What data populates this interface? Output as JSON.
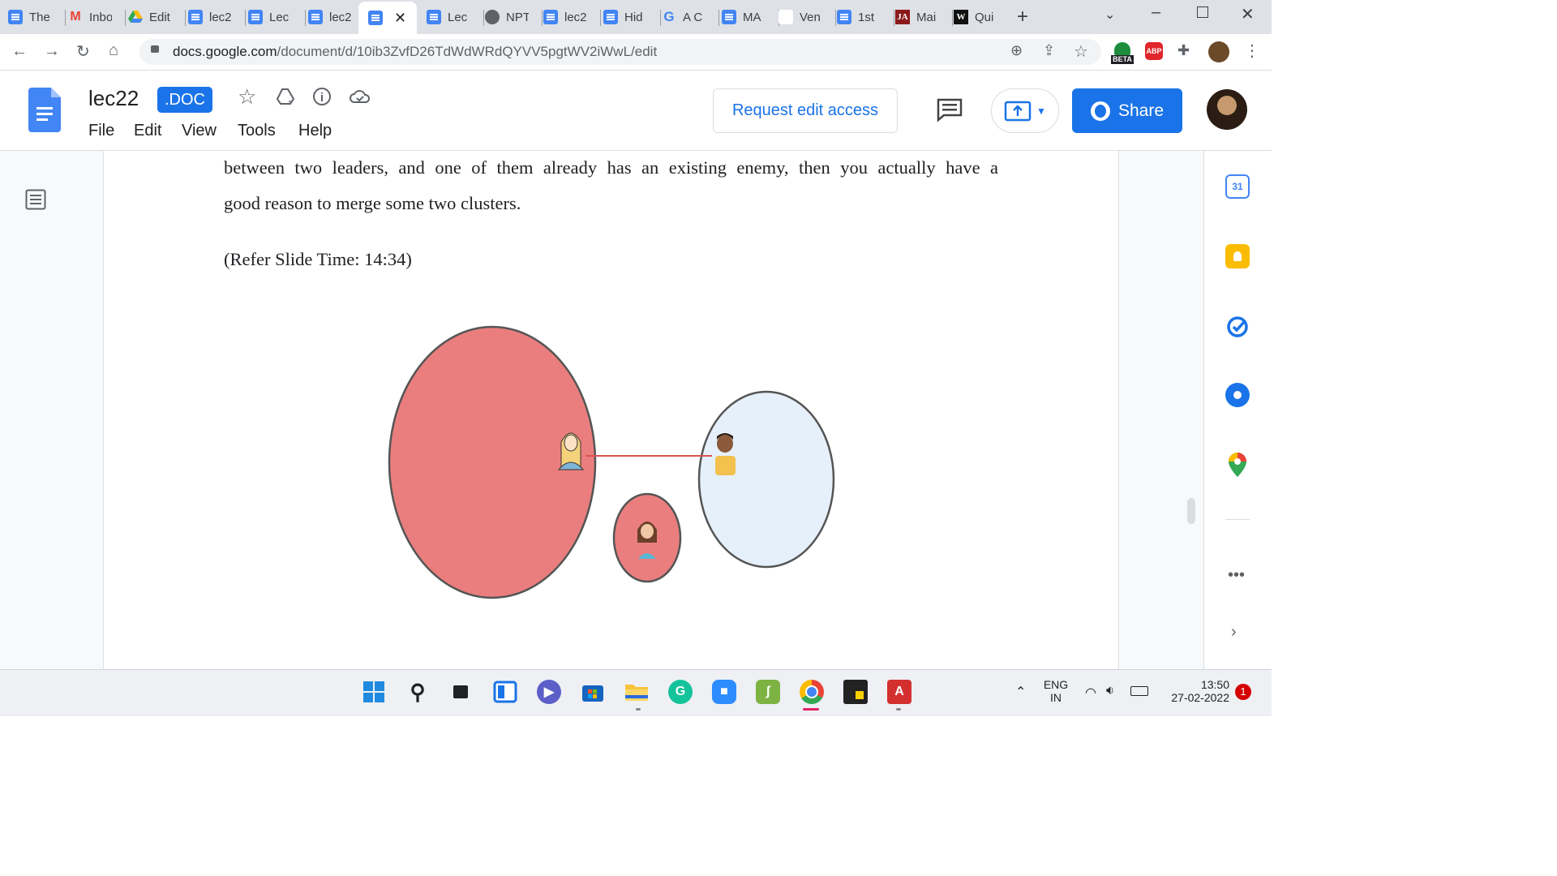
{
  "browser": {
    "tabs": [
      {
        "label": "The",
        "icon": "docs-icon"
      },
      {
        "label": "Inbo",
        "icon": "gmail-icon"
      },
      {
        "label": "Edit",
        "icon": "drive-icon"
      },
      {
        "label": "lec2",
        "icon": "docs-icon"
      },
      {
        "label": "Lec",
        "icon": "docs-icon"
      },
      {
        "label": "lec2",
        "icon": "docs-icon"
      },
      {
        "label": "",
        "icon": "docs-icon",
        "active": true
      },
      {
        "label": "Lec",
        "icon": "docs-icon"
      },
      {
        "label": "NPT",
        "icon": "globe-icon"
      },
      {
        "label": "lec2",
        "icon": "docs-icon"
      },
      {
        "label": "Hid",
        "icon": "docs-icon"
      },
      {
        "label": "A C",
        "icon": "google-icon"
      },
      {
        "label": "MA",
        "icon": "docs-icon"
      },
      {
        "label": "Ven",
        "icon": "blank-icon"
      },
      {
        "label": "1st",
        "icon": "docs-icon"
      },
      {
        "label": "Mai",
        "icon": "ja-icon"
      },
      {
        "label": "Qui",
        "icon": "w-icon"
      }
    ],
    "url_host": "docs.google.com",
    "url_path": "/document/d/10ib3ZvfD26TdWdWRdQYVV5pgtWV2iWwL/edit",
    "beta_label": "BETA",
    "abp_label": "ABP"
  },
  "docs": {
    "title": "lec22",
    "format_badge": ".DOC",
    "menu": [
      "File",
      "Edit",
      "View",
      "Tools",
      "Help"
    ],
    "request_edit": "Request edit access",
    "share": "Share"
  },
  "document": {
    "paragraph_line1": "between two leaders, and one of them already has an existing enemy, then you actually have a",
    "paragraph_line2": "good reason to merge some two clusters.",
    "slide_ref": "(Refer Slide Time: 14:34)"
  },
  "side_panel": {
    "calendar_day": "31"
  },
  "taskbar": {
    "lang": "ENG",
    "region": "IN",
    "time": "13:50",
    "date": "27-02-2022",
    "notification_count": "1"
  },
  "colors": {
    "cluster_large": "#ea7e7e",
    "cluster_small": "#ea7e7e",
    "cluster_right": "#e6f0fa",
    "link_line": "#d9534f",
    "brand_blue": "#1a73e8"
  }
}
